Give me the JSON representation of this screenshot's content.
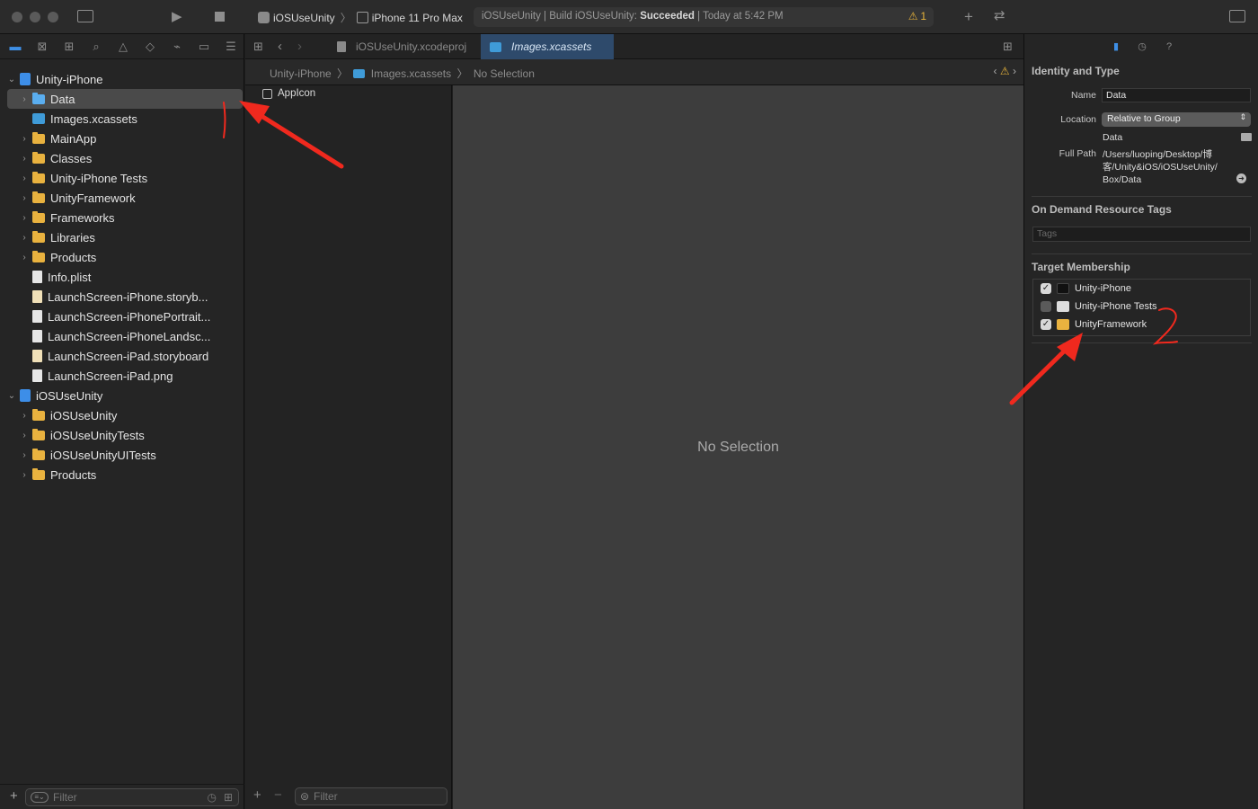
{
  "toolbar": {
    "scheme_name": "iOSUseUnity",
    "device_name": "iPhone 11 Pro Max",
    "activity_prefix": "iOSUseUnity | Build iOSUseUnity: ",
    "activity_status": "Succeeded",
    "activity_time": " | Today at 5:42 PM",
    "warning_count": "1"
  },
  "navigator": {
    "items": [
      {
        "label": "Unity-iPhone",
        "indent": 0,
        "expanded": true,
        "icon": "project-icon"
      },
      {
        "label": "Data",
        "indent": 1,
        "collapsed": true,
        "icon": "blue-folder-icon",
        "selected": true
      },
      {
        "label": "Images.xcassets",
        "indent": 1,
        "icon": "asset-catalog-icon"
      },
      {
        "label": "MainApp",
        "indent": 1,
        "collapsed": true,
        "icon": "folder-icon"
      },
      {
        "label": "Classes",
        "indent": 1,
        "collapsed": true,
        "icon": "folder-icon"
      },
      {
        "label": "Unity-iPhone Tests",
        "indent": 1,
        "collapsed": true,
        "icon": "folder-icon"
      },
      {
        "label": "UnityFramework",
        "indent": 1,
        "collapsed": true,
        "icon": "folder-icon"
      },
      {
        "label": "Frameworks",
        "indent": 1,
        "collapsed": true,
        "icon": "folder-icon"
      },
      {
        "label": "Libraries",
        "indent": 1,
        "collapsed": true,
        "icon": "folder-icon"
      },
      {
        "label": "Products",
        "indent": 1,
        "collapsed": true,
        "icon": "folder-icon"
      },
      {
        "label": "Info.plist",
        "indent": 1,
        "icon": "file-icon"
      },
      {
        "label": "LaunchScreen-iPhone.storyb...",
        "indent": 1,
        "icon": "storyboard-icon"
      },
      {
        "label": "LaunchScreen-iPhonePortrait...",
        "indent": 1,
        "icon": "file-icon"
      },
      {
        "label": "LaunchScreen-iPhoneLandsc...",
        "indent": 1,
        "icon": "file-icon"
      },
      {
        "label": "LaunchScreen-iPad.storyboard",
        "indent": 1,
        "icon": "storyboard-icon"
      },
      {
        "label": "LaunchScreen-iPad.png",
        "indent": 1,
        "icon": "file-icon"
      },
      {
        "label": "iOSUseUnity",
        "indent": 0,
        "expanded": true,
        "icon": "project-icon"
      },
      {
        "label": "iOSUseUnity",
        "indent": 1,
        "collapsed": true,
        "icon": "folder-icon"
      },
      {
        "label": "iOSUseUnityTests",
        "indent": 1,
        "collapsed": true,
        "icon": "folder-icon"
      },
      {
        "label": "iOSUseUnityUITests",
        "indent": 1,
        "collapsed": true,
        "icon": "folder-icon"
      },
      {
        "label": "Products",
        "indent": 1,
        "collapsed": true,
        "icon": "folder-icon"
      }
    ],
    "filter_placeholder": "Filter"
  },
  "editor": {
    "tabs": [
      {
        "label": "iOSUseUnity.xcodeproj",
        "active": false
      },
      {
        "label": "Images.xcassets",
        "active": true
      }
    ],
    "breadcrumb": [
      "Unity-iPhone",
      "Images.xcassets",
      "No Selection"
    ],
    "asset_items": [
      "AppIcon"
    ],
    "asset_filter_placeholder": "Filter",
    "empty_message": "No Selection"
  },
  "inspector": {
    "identity_title": "Identity and Type",
    "name_label": "Name",
    "name_value": "Data",
    "location_label": "Location",
    "location_value": "Relative to Group",
    "location_sub": "Data",
    "fullpath_label": "Full Path",
    "fullpath_lines": [
      "/Users/luoping/Desktop/博",
      "客/Unity&iOS/iOSUseUnity/",
      "Box/Data"
    ],
    "ondemand_title": "On Demand Resource Tags",
    "tags_placeholder": "Tags",
    "membership_title": "Target Membership",
    "targets": [
      {
        "label": "Unity-iPhone",
        "checked": true
      },
      {
        "label": "Unity-iPhone Tests",
        "checked": false
      },
      {
        "label": "UnityFramework",
        "checked": true
      }
    ]
  },
  "colors": {
    "accent": "#3e8fe6",
    "annotation_red": "#f0291e",
    "folder_yellow": "#e9b23f",
    "warning": "#e7b33a"
  }
}
